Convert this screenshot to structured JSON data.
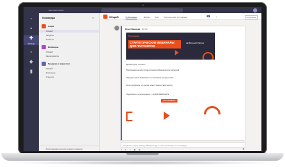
{
  "app": {
    "title": "Microsoft Teams"
  },
  "rail": {
    "items": [
      {
        "icon": "activity-icon",
        "glyph": "◦"
      },
      {
        "icon": "chat-icon",
        "glyph": "▪"
      },
      {
        "icon": "teams-icon",
        "glyph": "✚",
        "label": "Команды",
        "active": true
      },
      {
        "icon": "calendar-icon",
        "glyph": "▫"
      },
      {
        "icon": "calls-icon",
        "glyph": "◆"
      },
      {
        "icon": "files-icon",
        "glyph": "▮"
      }
    ]
  },
  "channels": {
    "header": "Команды",
    "filter": "⌕",
    "teams": [
      {
        "name": "Акции",
        "color": "#e94e1b",
        "channels": [
          "Общий",
          "Ресурсы",
          "Новости"
        ]
      },
      {
        "name": "Вебинары",
        "color": "#b146c2",
        "channels": [
          "Общий",
          "Мероприятия"
        ]
      },
      {
        "name": "Продажи и маркетинг",
        "color": "#6264a7",
        "channels": [
          "Общий",
          "Партнеры",
          "Клиенты"
        ]
      }
    ],
    "footer": "Присоединиться или создать команду"
  },
  "main": {
    "channel_name": "Общий",
    "tabs": [
      "Публикации",
      "Файлы",
      "Wiki",
      "Партнерская программа"
    ],
    "badge": "+",
    "meet_label": "Собрание",
    "post": {
      "author": "Юлия Иванова",
      "time": "10:32",
      "banner_small": "Партнерам",
      "banner_title": "СТРАТЕГИЧЕСКИЕ ВЕБИНАРЫ ДЛЯ ПАРТНЕРОВ",
      "banner_logo": "■ Microsoft Partner",
      "lines": [
        "Добрый день, коллеги!",
        "Приглашаем на цикл стратегических вебинаров для партнеров",
        "Обсудим новые возможности и ключевые тренды рынка",
        "Регистрируйтесь по ссылке ниже и зовите своих коллег"
      ],
      "promo": "Подробности и регистрация — на ВСЕ ВЕБИНАРЫ",
      "cta": "УЧАСТВОВАТЬ"
    },
    "compose_placeholder": "Начните новую беседу. Введите @, чтобы упомянуть кого-нибудь.",
    "compose_tools": "A ⊕ ☺ ▣ ▤ ⋯"
  }
}
